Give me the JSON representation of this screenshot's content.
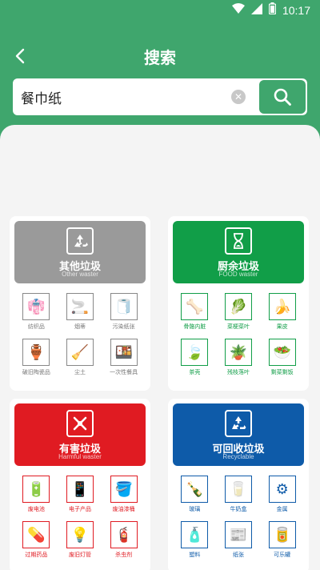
{
  "status": {
    "time": "10:17",
    "wifi_icon": "wifi-icon",
    "signal_icon": "signal-icon",
    "battery_icon": "battery-icon"
  },
  "header": {
    "title": "搜索",
    "back_icon": "back-arrow-icon"
  },
  "search": {
    "value": "餐巾纸",
    "clear_icon": "clear-icon",
    "search_icon": "search-icon"
  },
  "categories": [
    {
      "title": "其他垃圾",
      "subtitle": "Other waster",
      "color": "#9a9a9a",
      "items": [
        {
          "label": "纺织品",
          "icon": "clothing-icon"
        },
        {
          "label": "烟蒂",
          "icon": "cigarette-icon"
        },
        {
          "label": "污染纸张",
          "icon": "tissue-icon"
        },
        {
          "label": "破旧陶瓷品",
          "icon": "ceramic-icon"
        },
        {
          "label": "尘土",
          "icon": "broom-icon"
        },
        {
          "label": "一次性餐具",
          "icon": "tableware-icon"
        }
      ]
    },
    {
      "title": "厨余垃圾",
      "subtitle": "FOOD waster",
      "color": "#119e48",
      "items": [
        {
          "label": "骨骼内脏",
          "icon": "bone-icon"
        },
        {
          "label": "菜梗菜叶",
          "icon": "vegetable-icon"
        },
        {
          "label": "果皮",
          "icon": "fruit-peel-icon"
        },
        {
          "label": "茶壳",
          "icon": "tea-shell-icon"
        },
        {
          "label": "残枝落叶",
          "icon": "plant-icon"
        },
        {
          "label": "剩菜剩饭",
          "icon": "leftovers-icon"
        }
      ]
    },
    {
      "title": "有害垃圾",
      "subtitle": "Harmful waster",
      "color": "#e01b22",
      "items": [
        {
          "label": "废电池",
          "icon": "battery-waste-icon"
        },
        {
          "label": "电子产品",
          "icon": "phone-icon"
        },
        {
          "label": "废油漆桶",
          "icon": "paint-bucket-icon"
        },
        {
          "label": "过期药品",
          "icon": "medicine-icon"
        },
        {
          "label": "废旧灯管",
          "icon": "bulb-icon"
        },
        {
          "label": "杀虫剂",
          "icon": "spray-icon"
        }
      ]
    },
    {
      "title": "可回收垃圾",
      "subtitle": "Recyclable",
      "color": "#0e5ba9",
      "items": [
        {
          "label": "玻璃",
          "icon": "glass-bottle-icon"
        },
        {
          "label": "牛奶盒",
          "icon": "milk-box-icon"
        },
        {
          "label": "金属",
          "icon": "metal-icon"
        },
        {
          "label": "塑料",
          "icon": "plastic-bottle-icon"
        },
        {
          "label": "纸张",
          "icon": "paper-icon"
        },
        {
          "label": "可乐罐",
          "icon": "can-icon"
        }
      ]
    }
  ]
}
